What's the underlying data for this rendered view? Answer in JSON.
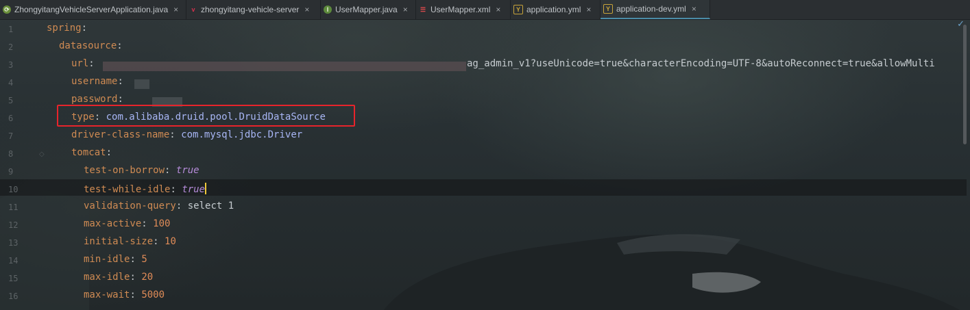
{
  "tabs": [
    {
      "label": "ZhongyitangVehicleServerApplication.java",
      "icon": "spring-app-icon",
      "closable": true
    },
    {
      "label": "zhongyitang-vehicle-server",
      "icon": "maven-module-icon",
      "closable": true
    },
    {
      "label": "UserMapper.java",
      "icon": "interface-icon",
      "closable": true
    },
    {
      "label": "UserMapper.xml",
      "icon": "xml-file-icon",
      "closable": true
    },
    {
      "label": "application.yml",
      "icon": "yaml-file-icon",
      "closable": true
    },
    {
      "label": "application-dev.yml",
      "icon": "yaml-file-icon",
      "closable": true,
      "active": true
    }
  ],
  "close_glyph": "×",
  "editor": {
    "line_numbers": [
      "1",
      "2",
      "3",
      "4",
      "5",
      "6",
      "7",
      "8",
      "9",
      "10",
      "11",
      "12",
      "13",
      "14",
      "15",
      "16"
    ],
    "spring": "spring",
    "datasource": "datasource",
    "url_key": "url",
    "url_tail": "ag_admin_v1?useUnicode=true&characterEncoding=UTF-8&autoReconnect=true&allowMulti",
    "username_key": "username",
    "password_key": "password",
    "type_key": "type",
    "type_value": "com.alibaba.druid.pool.DruidDataSource",
    "driver_key": "driver-class-name",
    "driver_value": "com.mysql.jdbc.Driver",
    "tomcat": "tomcat",
    "test_on_borrow_key": "test-on-borrow",
    "test_on_borrow_value": "true",
    "test_while_idle_key": "test-while-idle",
    "test_while_idle_value": "true",
    "validation_query_key": "validation-query",
    "validation_query_value": "select 1",
    "max_active_key": "max-active",
    "max_active_value": "100",
    "initial_size_key": "initial-size",
    "initial_size_value": "10",
    "min_idle_key": "min-idle",
    "min_idle_value": "5",
    "max_idle_key": "max-idle",
    "max_idle_value": "20",
    "max_wait_key": "max-wait",
    "max_wait_value": "5000",
    "colon": ":"
  },
  "colors": {
    "highlight_box": "#e8242b",
    "active_tab_underline": "#4b8ca8",
    "caret": "#f0c93a"
  }
}
